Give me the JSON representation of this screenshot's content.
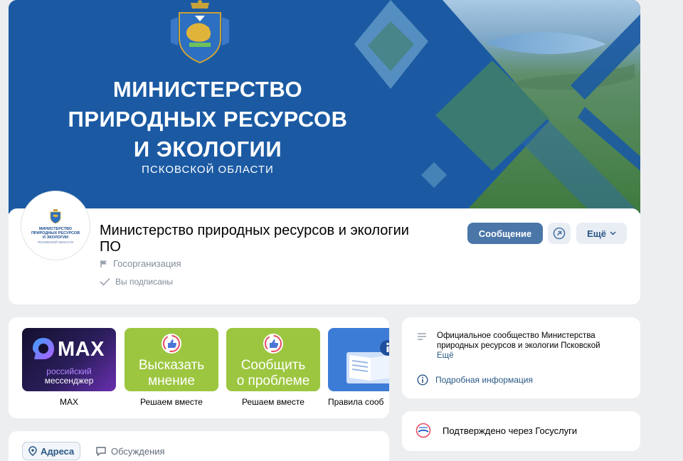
{
  "cover": {
    "title_line1": "МИНИСТЕРСТВО",
    "title_line2": "ПРИРОДНЫХ РЕСУРСОВ",
    "title_line3": "И ЭКОЛОГИИ",
    "subtitle": "ПСКОВСКОЙ ОБЛАСТИ",
    "colors": {
      "blue": "#1b5aa3",
      "water": "#5d9ccc",
      "forest": "#4f8a4a"
    }
  },
  "avatar": {
    "line1": "МИНИСТЕРСТВО",
    "line2": "ПРИРОДНЫХ РЕСУРСОВ",
    "line3": "И ЭКОЛОГИИ",
    "line4": "ПСКОВСКОЙ ОБЛАСТИ"
  },
  "profile": {
    "name": "Министерство природных ресурсов и экологии ПО",
    "category": "Госорганизация",
    "subscribed": "Вы подписаны",
    "message_button": "Сообщение",
    "more_button": "Ещё",
    "accent": "#4a76a8"
  },
  "apps": [
    {
      "caption": "MAX",
      "logo": "MAX",
      "line1": "российский",
      "line2": "мессенджер"
    },
    {
      "caption": "Решаем вместе",
      "line1": "Высказать",
      "line2": "мнение"
    },
    {
      "caption": "Решаем вместе",
      "line1": "Сообщить",
      "line2": "о проблеме"
    },
    {
      "caption": "Правила сооб"
    }
  ],
  "tabs": {
    "addresses": "Адреса",
    "discussions": "Обсуждения"
  },
  "info": {
    "description": "Официальное сообщество Министерства природных ресурсов и экологии Псковской",
    "more": "Ещё",
    "details": "Подробная информация"
  },
  "gosuslugi": {
    "text": "Подтверждено через Госуслуги"
  }
}
